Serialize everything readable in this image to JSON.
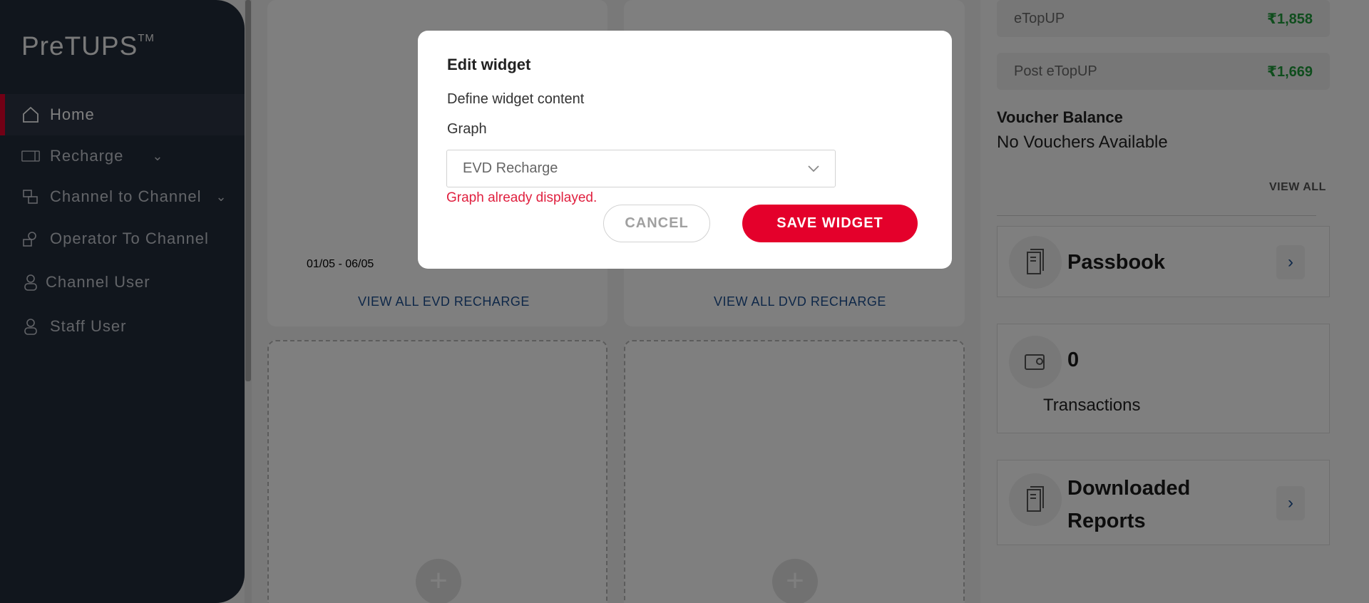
{
  "app": {
    "name": "PreTUPS",
    "trademark": "TM"
  },
  "sidebar": {
    "items": [
      {
        "label": "Home",
        "icon": "home-icon",
        "active": true
      },
      {
        "label": "Recharge",
        "icon": "ticket-icon",
        "expandable": true
      },
      {
        "label": "Channel to Channel",
        "icon": "channel-transfer-icon",
        "expandable": true
      },
      {
        "label": "Operator To Channel",
        "icon": "operator-channel-icon"
      },
      {
        "label": "Channel User",
        "icon": "user-icon"
      },
      {
        "label": "Staff User",
        "icon": "user-icon"
      }
    ]
  },
  "main": {
    "evd_card": {
      "date_range": "01/05 - 06/05",
      "link": "VIEW ALL EVD RECHARGE"
    },
    "dvd_card": {
      "link": "VIEW ALL DVD RECHARGE"
    }
  },
  "right_panel": {
    "balances": [
      {
        "name": "eTopUP",
        "amount": "₹1,858"
      },
      {
        "name": "Post eTopUP",
        "amount": "₹1,669"
      }
    ],
    "voucher_title": "Voucher Balance",
    "voucher_status": "No Vouchers Available",
    "view_all": "VIEW ALL",
    "passbook": {
      "title": "Passbook",
      "icon": "document-icon"
    },
    "transactions": {
      "count": "0",
      "label": "Transactions",
      "icon": "wallet-icon"
    },
    "downloaded_reports": {
      "title_line1": "Downloaded",
      "title_line2": "Reports",
      "icon": "document-icon"
    }
  },
  "modal": {
    "title": "Edit widget",
    "subtitle": "Define widget content",
    "field_label": "Graph",
    "selected": "EVD Recharge",
    "error": "Graph already displayed.",
    "cancel": "CANCEL",
    "save": "SAVE WIDGET"
  },
  "colors": {
    "sidebar_bg": "#232c3a",
    "accent": "#e4002b",
    "amount": "#1f9a3a",
    "link": "#1d4f91",
    "error": "#e0203f"
  }
}
